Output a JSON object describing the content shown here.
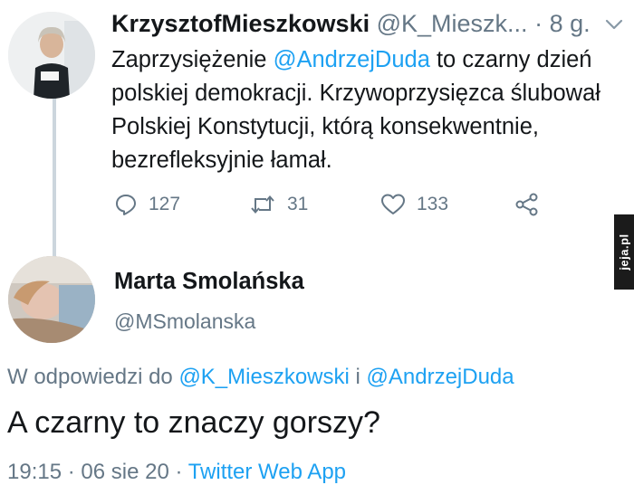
{
  "tweet": {
    "author_name": "KrzysztofMieszkowski",
    "author_handle": "@K_Mieszk...",
    "separator": "·",
    "time": "8 g.",
    "text_part1": "Zaprzysiężenie ",
    "mention": "@AndrzejDuda",
    "text_part2": "  to czarny dzień  polskiej demokracji. Krzywoprzysięzca ślubował Polskiej Konstytucji, którą konsekwentnie, bezrefleksyjnie łamał.",
    "replies": "127",
    "retweets": "31",
    "likes": "133"
  },
  "reply": {
    "author_name": "Marta Smolańska",
    "author_handle": "@MSmolanska",
    "in_reply_prefix": "W odpowiedzi do ",
    "in_reply_user1": "@K_Mieszkowski",
    "in_reply_joiner": " i ",
    "in_reply_user2": "@AndrzejDuda",
    "text": "A czarny to znaczy gorszy?",
    "time": "19:15",
    "separator1": " · ",
    "date": "06 sie 20",
    "separator2": " · ",
    "source": "Twitter Web App"
  },
  "watermark": {
    "text": "jeja.pl"
  },
  "colors": {
    "accent": "#1da1f2",
    "muted": "#657786",
    "text": "#14171a",
    "thread_line": "#ccd6dd"
  },
  "icons": [
    "reply-icon",
    "retweet-icon",
    "like-icon",
    "share-icon",
    "chevron-down-icon"
  ]
}
